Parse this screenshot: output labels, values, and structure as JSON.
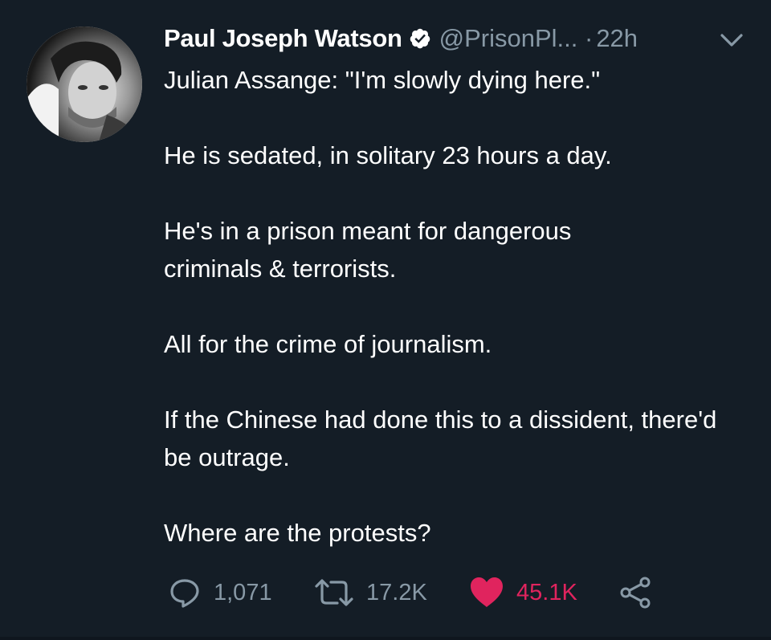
{
  "user": {
    "name": "Paul Joseph Watson",
    "handle": "@PrisonPl...",
    "separator": "·",
    "time": "22h"
  },
  "tweet": {
    "paragraphs": [
      "Julian Assange: \"I'm slowly dying here.\"",
      "He is sedated, in solitary 23 hours a day.",
      "He's in a prison meant for dangerous criminals & terrorists.",
      "All for the crime of journalism.",
      "If the Chinese had done this to a dissident, there'd be outrage.",
      "Where are the protests?"
    ]
  },
  "stats": {
    "replies": "1,071",
    "retweets": "17.2K",
    "likes": "45.1K"
  },
  "icons": {
    "verified": "verified-badge-icon",
    "menu": "chevron-down-icon",
    "reply": "reply-icon",
    "retweet": "retweet-icon",
    "like": "heart-icon",
    "share": "share-icon"
  },
  "colors": {
    "background": "#141d26",
    "text": "#ffffff",
    "muted": "#8899a6",
    "like": "#e0245e"
  }
}
